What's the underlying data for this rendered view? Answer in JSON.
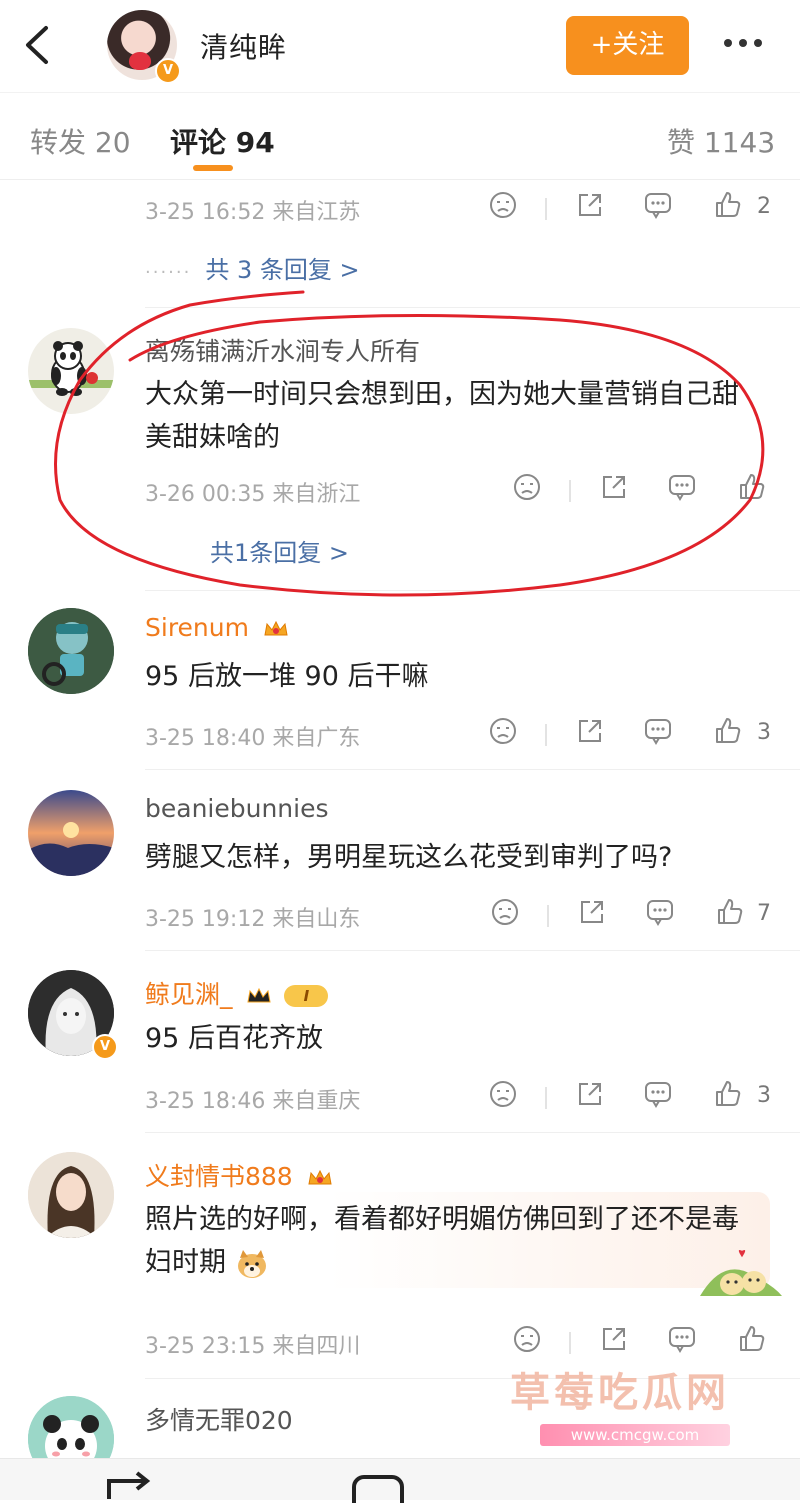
{
  "header": {
    "name": "清纯眸",
    "verified": "V",
    "follow_label": "+关注"
  },
  "tabs": [
    {
      "label": "转发 20"
    },
    {
      "label": "评论 94"
    },
    {
      "label": "赞 1143"
    }
  ],
  "top_meta": {
    "time": "3-25 16:52",
    "location": "来自江苏",
    "like_count": "2",
    "replies": "共 3 条回复 >"
  },
  "comments": [
    {
      "username": "离殇铺满沂水涧专人所有",
      "text": "大众第一时间只会想到田，因为她大量营销自己甜美甜妹啥的",
      "time": "3-26 00:35",
      "location": "来自浙江",
      "like_count": "",
      "replies": "共1条回复 >"
    },
    {
      "username": "Sirenum",
      "text": "95 后放一堆 90 后干嘛",
      "time": "3-25 18:40",
      "location": "来自广东",
      "like_count": "3"
    },
    {
      "username": "beaniebunnies",
      "text": "劈腿又怎样，男明星玩这么花受到审判了吗?",
      "time": "3-25 19:12",
      "location": "来自山东",
      "like_count": "7"
    },
    {
      "username": "鲸见渊_",
      "level": "I",
      "text": "95 后百花齐放",
      "time": "3-25 18:46",
      "location": "来自重庆",
      "like_count": "3"
    },
    {
      "username": "义封情书888",
      "text": "照片选的好啊，看着都好明媚仿佛回到了还不是毒妇时期",
      "time": "3-25 23:15",
      "location": "来自四川",
      "like_count": ""
    },
    {
      "username": "多情无罪020"
    }
  ],
  "watermark": {
    "title": "草莓吃瓜网",
    "url": "www.cmcgw.com"
  },
  "colors": {
    "accent": "#f7901e",
    "link": "#4a6fa5",
    "username_orange": "#f07b1c",
    "annotation_red": "#e0222a"
  }
}
